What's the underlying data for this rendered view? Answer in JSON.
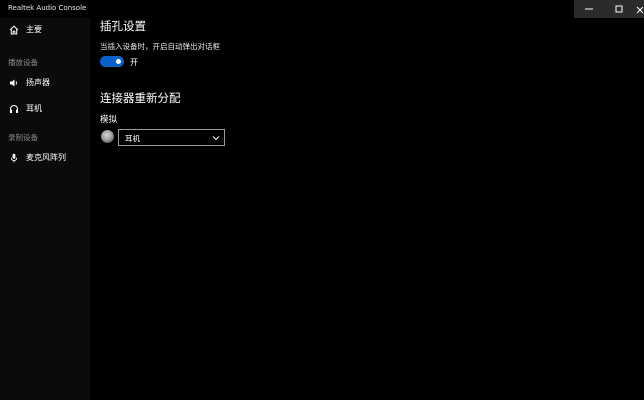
{
  "window": {
    "title": "Realtek Audio Console"
  },
  "sidebar": {
    "home": {
      "label": "主要",
      "icon": "home-icon"
    },
    "playback_section": "播放设备",
    "speaker": {
      "label": "扬声器",
      "icon": "speaker-icon"
    },
    "headphone": {
      "label": "耳机",
      "icon": "headphone-icon"
    },
    "record_section": "录制设备",
    "mic": {
      "label": "麦克风阵列",
      "icon": "microphone-icon"
    }
  },
  "main": {
    "jack_settings_title": "插孔设置",
    "jack_detect_desc": "当插入设备时，开启自动弹出对话框",
    "toggle_state": "开",
    "toggle_on": true,
    "reassign_title": "连接器重新分配",
    "analog_label": "模拟",
    "connector_select_value": "耳机"
  },
  "colors": {
    "accent": "#0a62c9",
    "background": "#000000",
    "sidebar_bg": "#0b0b0b",
    "section_text": "#8a8a8a"
  }
}
